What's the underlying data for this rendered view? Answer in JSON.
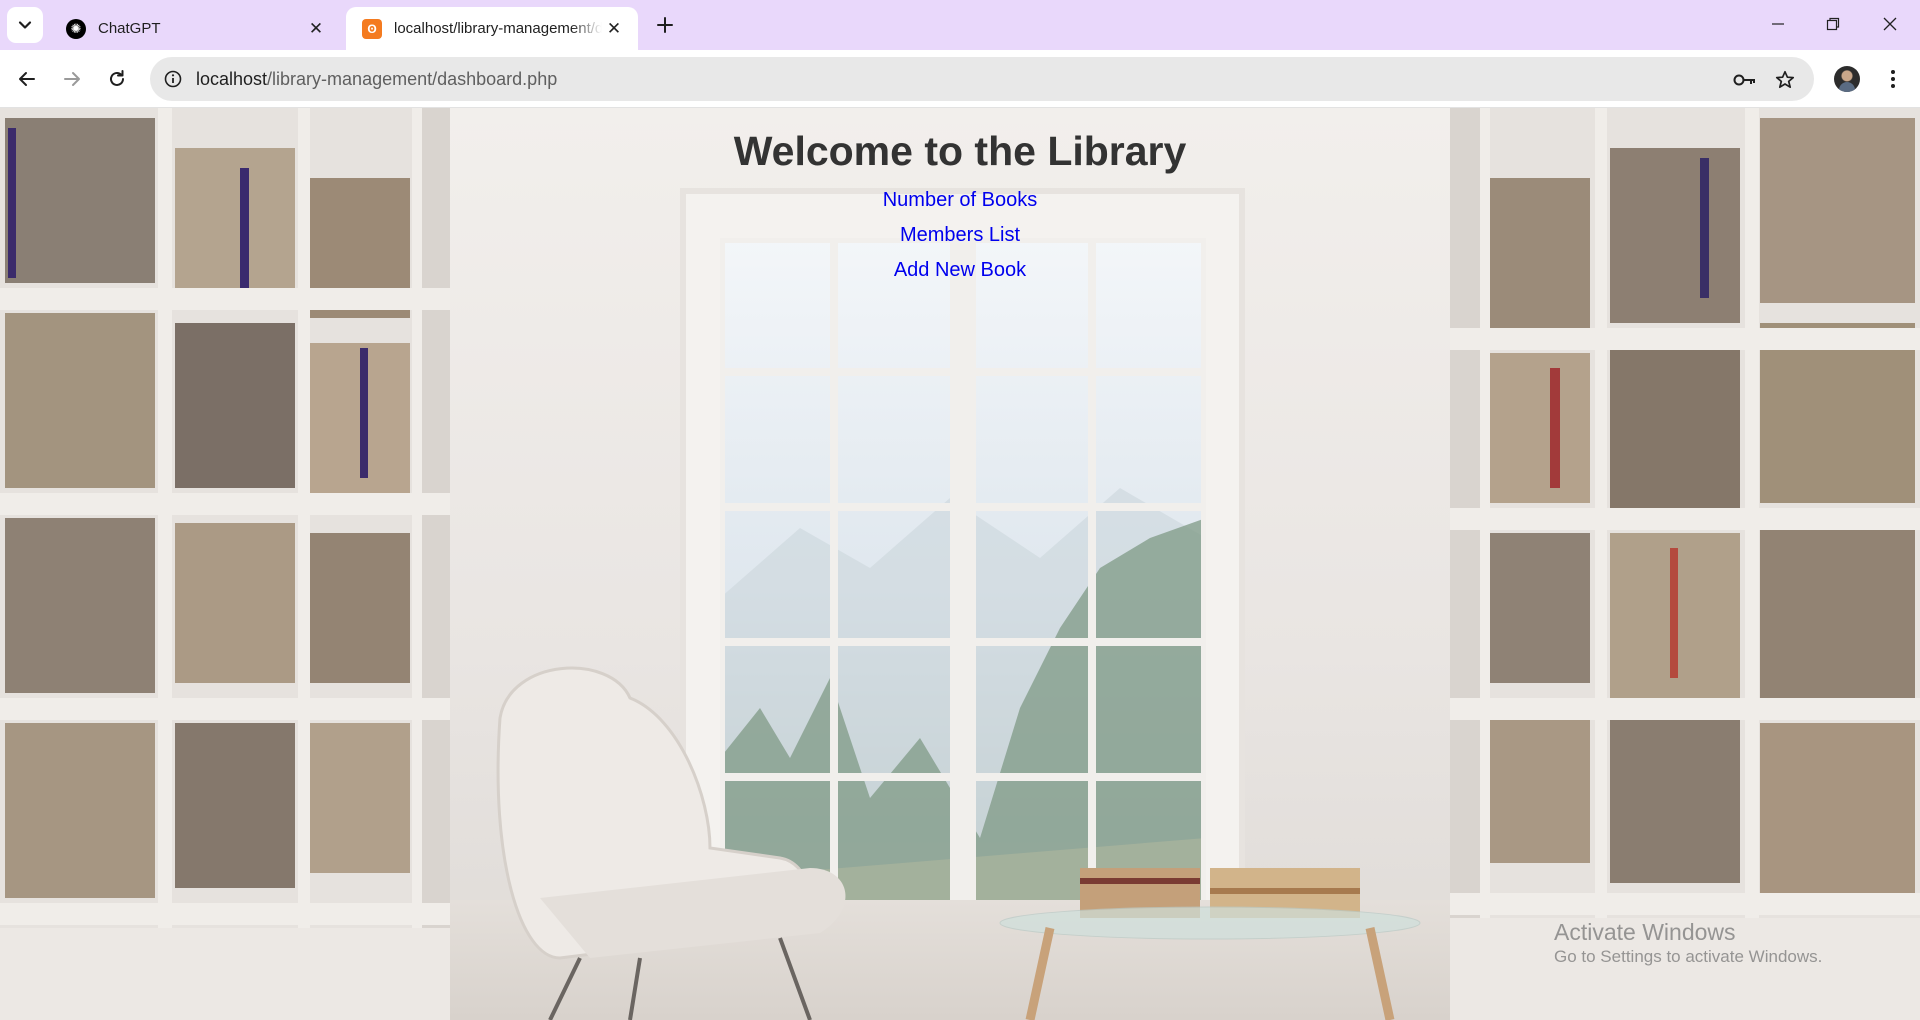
{
  "browser": {
    "tabs": [
      {
        "title": "ChatGPT",
        "active": false,
        "favicon": "chatgpt-icon"
      },
      {
        "title": "localhost/library-management/dashboard.php",
        "active": true,
        "favicon": "xampp-icon"
      }
    ],
    "address_bar": {
      "host": "localhost",
      "path": "/library-management/dashboard.php"
    }
  },
  "page": {
    "title": "Welcome to the Library",
    "links": [
      {
        "label": "Number of Books"
      },
      {
        "label": "Members List"
      },
      {
        "label": "Add New Book"
      }
    ]
  },
  "os_watermark": {
    "title": "Activate Windows",
    "subtitle": "Go to Settings to activate Windows."
  },
  "colors": {
    "tabstrip_bg": "#e9d8fb",
    "link": "#0000ee",
    "heading": "#333333"
  }
}
